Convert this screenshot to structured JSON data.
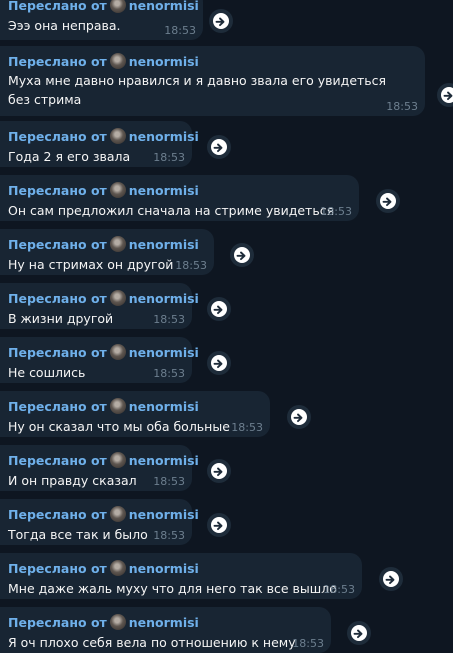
{
  "chat": {
    "forwarded_prefix": "Переслано от",
    "author": "nenormisi",
    "messages": [
      {
        "text": "Эээ она неправа.",
        "time": "18:53"
      },
      {
        "text": "Муха мне давно нравился и я давно звала его увидеться без стрима",
        "time": "18:53"
      },
      {
        "text": "Года 2 я его звала",
        "time": "18:53"
      },
      {
        "text": "Он сам предложил сначала на стриме увидеться",
        "time": "18:53"
      },
      {
        "text": "Ну на стримах он другой",
        "time": "18:53"
      },
      {
        "text": "В жизни другой",
        "time": "18:53"
      },
      {
        "text": "Не сошлись",
        "time": "18:53"
      },
      {
        "text": "Ну он сказал что мы оба больные",
        "time": "18:53"
      },
      {
        "text": "И он правду сказал",
        "time": "18:53"
      },
      {
        "text": "Тогда все так и было",
        "time": "18:53"
      },
      {
        "text": "Мне даже жаль муху что для него так все вышло",
        "time": "18:53"
      },
      {
        "text": "Я оч плохо себя вела по отношению к нему",
        "time": "18:53"
      }
    ]
  },
  "icons": {
    "share": "share-arrow-icon"
  },
  "colors": {
    "background": "#0e1621",
    "bubble": "#182533",
    "accent": "#6fb0ea"
  }
}
